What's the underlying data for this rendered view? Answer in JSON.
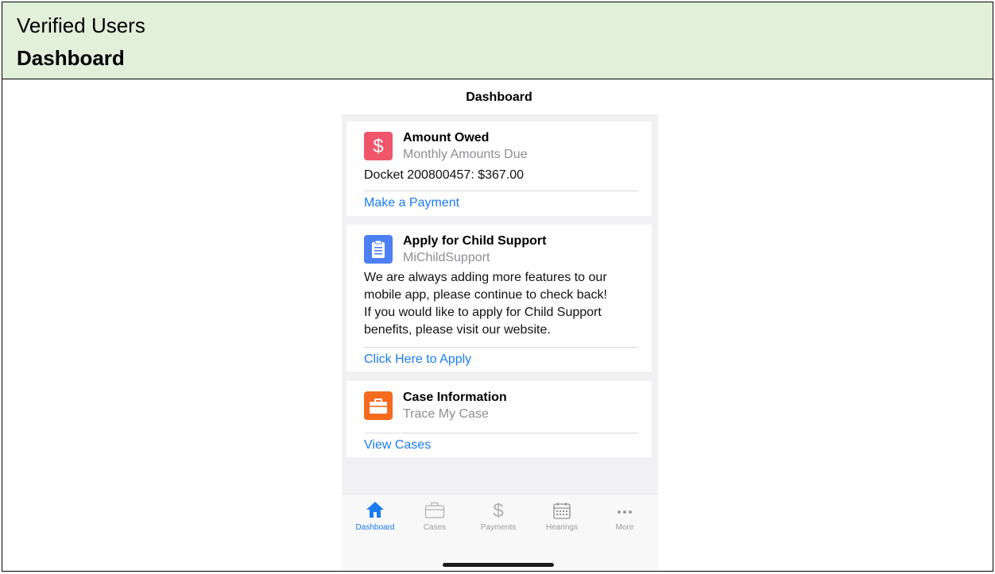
{
  "header": {
    "subtitle": "Verified Users",
    "title": "Dashboard"
  },
  "app": {
    "nav_title": "Dashboard",
    "cards": [
      {
        "icon": "dollar-icon",
        "icon_color": "#f0566b",
        "title": "Amount Owed",
        "subtitle": "Monthly Amounts Due",
        "body": [
          "Docket 200800457: $367.00"
        ],
        "link": "Make a Payment"
      },
      {
        "icon": "clipboard-icon",
        "icon_color": "#4d7ff5",
        "title": "Apply for Child Support",
        "subtitle": "MiChildSupport",
        "body": [
          "We are always adding more features to our",
          "mobile app, please continue to check back!",
          "If you would like to apply for Child Support",
          "benefits, please visit our website."
        ],
        "link": "Click Here to Apply"
      },
      {
        "icon": "briefcase-icon",
        "icon_color": "#f56b1e",
        "title": "Case Information",
        "subtitle": "Trace My Case",
        "body": [],
        "link": "View Cases"
      }
    ],
    "tabs": [
      {
        "label": "Dashboard",
        "icon": "home-icon",
        "active": true
      },
      {
        "label": "Cases",
        "icon": "briefcase-icon",
        "active": false
      },
      {
        "label": "Payments",
        "icon": "dollar-icon",
        "active": false
      },
      {
        "label": "Hearings",
        "icon": "calendar-icon",
        "active": false
      },
      {
        "label": "More",
        "icon": "more-icon",
        "active": false
      }
    ],
    "accent_color": "#1a7cf2"
  }
}
